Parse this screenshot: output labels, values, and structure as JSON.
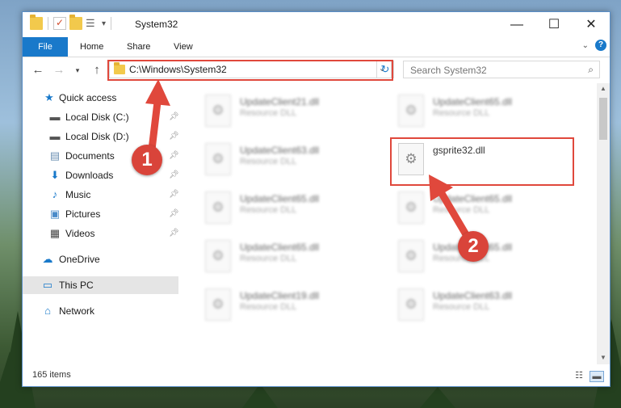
{
  "window": {
    "title": "System32",
    "controls": {
      "minimize": "—",
      "maximize": "☐",
      "close": "✕"
    }
  },
  "ribbon": {
    "tabs": [
      "File",
      "Home",
      "Share",
      "View"
    ]
  },
  "nav": {
    "address_path": "C:\\Windows\\System32",
    "search_placeholder": "Search System32"
  },
  "sidebar": {
    "items": [
      {
        "label": "Quick access",
        "icon": "star-icon"
      },
      {
        "label": "Local Disk (C:)",
        "icon": "drive-icon"
      },
      {
        "label": "Local Disk (D:)",
        "icon": "drive-icon"
      },
      {
        "label": "Documents",
        "icon": "documents-icon"
      },
      {
        "label": "Downloads",
        "icon": "download-arrow-icon"
      },
      {
        "label": "Music",
        "icon": "music-note-icon"
      },
      {
        "label": "Pictures",
        "icon": "pictures-icon"
      },
      {
        "label": "Videos",
        "icon": "film-icon"
      },
      {
        "label": "OneDrive",
        "icon": "cloud-icon"
      },
      {
        "label": "This PC",
        "icon": "monitor-icon"
      },
      {
        "label": "Network",
        "icon": "network-icon"
      }
    ]
  },
  "files": [
    {
      "name": "UpdateClient21.dll",
      "type": "Resource DLL"
    },
    {
      "name": "UpdateClient65.dll",
      "type": "Resource DLL"
    },
    {
      "name": "UpdateClient63.dll",
      "type": "Resource DLL"
    },
    {
      "name": "gsprite32.dll",
      "type": ""
    },
    {
      "name": "UpdateClient65.dll",
      "type": "Resource DLL"
    },
    {
      "name": "UpdateClient65.dll",
      "type": "Resource DLL"
    },
    {
      "name": "UpdateClient65.dll",
      "type": "Resource DLL"
    },
    {
      "name": "UpdateClient65.dll",
      "type": "Resource DLL"
    },
    {
      "name": "UpdateClient19.dll",
      "type": "Resource DLL"
    },
    {
      "name": "UpdateClient63.dll",
      "type": "Resource DLL"
    }
  ],
  "status": {
    "item_count": "165 items"
  },
  "annotations": {
    "step1": "1",
    "step2": "2",
    "arrow_color": "#e0483c"
  },
  "colors": {
    "accent": "#1979ca",
    "highlight": "#e0483c"
  }
}
